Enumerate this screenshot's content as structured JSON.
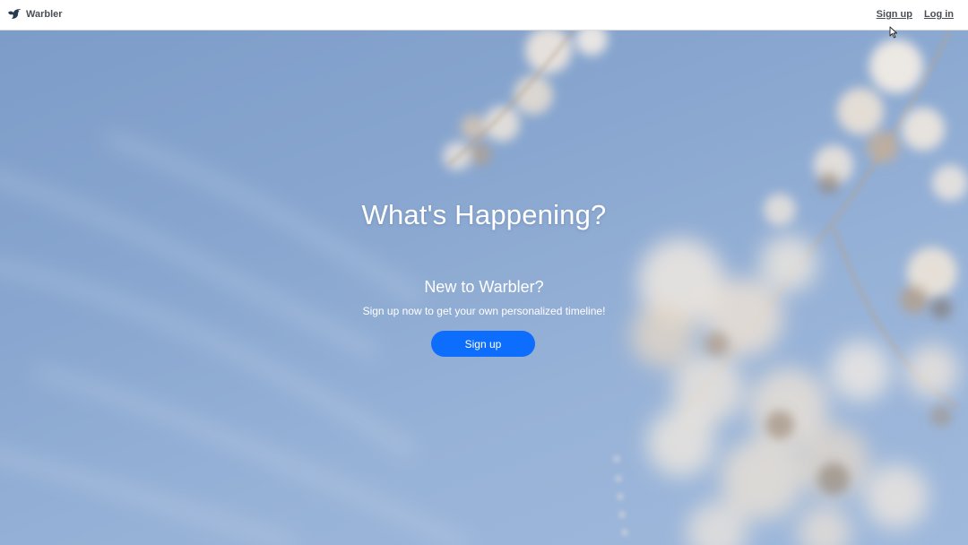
{
  "navbar": {
    "brand_name": "Warbler",
    "brand_icon": "bird-icon",
    "links": [
      {
        "label": "Sign up"
      },
      {
        "label": "Log in"
      }
    ]
  },
  "hero": {
    "headline": "What's Happening?",
    "subheading": "New to Warbler?",
    "tagline": "Sign up now to get your own personalized timeline!",
    "cta_label": "Sign up"
  },
  "colors": {
    "accent": "#0d6efd",
    "sky": "#8aa8d0",
    "navbar_bg": "#ffffff"
  }
}
